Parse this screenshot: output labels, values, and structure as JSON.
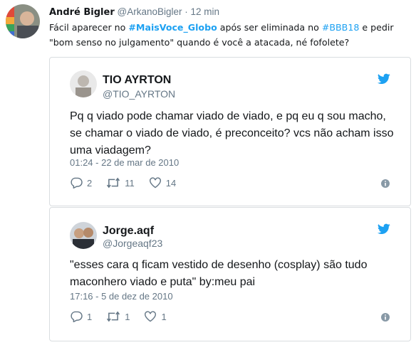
{
  "main_tweet": {
    "author_name": "André Bigler",
    "handle": "@ArkanoBigler",
    "separator": "·",
    "time": "12 min",
    "text_parts": {
      "p1": "Fácil aparecer no ",
      "tag1": "#MaisVoce_Globo",
      "p2": " após ser eliminada no ",
      "tag2": "#BBB18",
      "p3": " e pedir \"bom senso no julgamento\" quando é você a atacada, né fofolete?"
    }
  },
  "embeds": [
    {
      "name": "TIO AYRTON",
      "handle": "@TIO_AYRTON",
      "text": "Pq q viado pode chamar viado de viado, e pq eu q sou macho, se chamar o viado de viado, é preconceito? vcs não acham isso uma viadagem?",
      "timestamp": "01:24 - 22 de mar de 2010",
      "replies": "2",
      "retweets": "11",
      "likes": "14"
    },
    {
      "name": "Jorge.aqf",
      "handle": "@Jorgeaqf23",
      "text": "\"esses cara q ficam vestido de desenho (cosplay) são tudo maconhero viado e puta\" by:meu pai",
      "timestamp": "17:16 - 5 de dez de 2010",
      "replies": "1",
      "retweets": "1",
      "likes": "1"
    }
  ],
  "colors": {
    "link": "#1da1f2",
    "muted": "#657786",
    "text": "#14171a",
    "border": "#d9dde0"
  },
  "icons": [
    "reply-icon",
    "retweet-icon",
    "like-icon",
    "info-icon",
    "twitter-bird-icon"
  ]
}
